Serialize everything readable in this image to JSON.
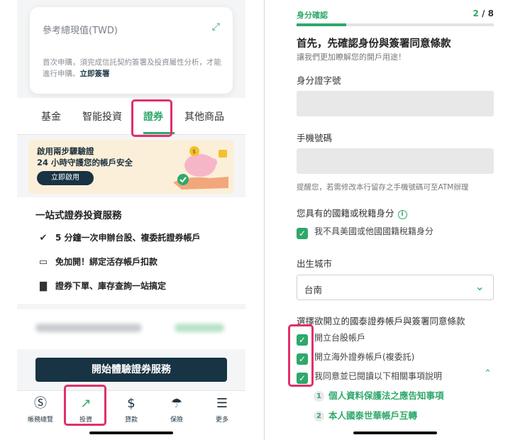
{
  "left": {
    "value_card": {
      "title": "參考總現值(TWD)",
      "expand_icon": "expand-icon",
      "desc_prefix": "首次申購，須完成信託契約簽署及投資屬性分析，才能進行申購。",
      "desc_link": "立即簽署"
    },
    "tabs": [
      "基金",
      "智能投資",
      "證券",
      "其他商品"
    ],
    "active_tab": "證券",
    "promo": {
      "line1": "啟用兩步驟驗證",
      "line2": "24 小時守護您的帳戶安全",
      "button": "立即啟用"
    },
    "service": {
      "title": "一站式證券投資服務",
      "rows": [
        {
          "icon": "speed-check-icon",
          "text": "5 分鐘一次申辦台股、複委託證券帳戶"
        },
        {
          "icon": "bank-card-icon",
          "text": "免加開！綁定活存帳戶扣款"
        },
        {
          "icon": "growth-chart-icon",
          "text": "證券下單、庫存查詢一站搞定"
        }
      ]
    },
    "cta": "開始體驗證券服務",
    "nav": [
      {
        "icon": "dollar-circle-icon",
        "label": "帳務總覽"
      },
      {
        "icon": "invest-chart-icon",
        "label": "投資"
      },
      {
        "icon": "money-bag-icon",
        "label": "貸款"
      },
      {
        "icon": "umbrella-icon",
        "label": "保險"
      },
      {
        "icon": "menu-icon",
        "label": "更多"
      }
    ],
    "active_nav": "投資"
  },
  "right": {
    "step_name": "身分確認",
    "step_current": "2",
    "step_total": "/ 8",
    "progress": 0.25,
    "heading": "首先，先確認身份與簽署同意條款",
    "subheading": "讓我們更加瞭解您的開戶用途！",
    "id_label": "身分證字號",
    "phone_label": "手機號碼",
    "phone_hint": "提醒您，若需修改本行留存之手機號碼可至ATM辦理",
    "nationality_label": "您具有的國籍或稅籍身分",
    "nationality_option": "我不具美國或他國國籍稅籍身分",
    "birth_city_label": "出生城市",
    "birth_city_value": "台南",
    "accounts_label": "選擇欲開立的國泰證券帳戶與簽署同意條款",
    "account_options": [
      "開立台股帳戶",
      "開立海外證券帳戶(複委託)",
      "我同意並已閱讀以下相關事項說明"
    ],
    "notices": [
      {
        "num": "1",
        "text": "個人資料保護法之應告知事項"
      },
      {
        "num": "2",
        "text": "本人國泰世華帳戶互轉"
      }
    ]
  },
  "colors": {
    "accent_green": "#2fa86b",
    "navy": "#173344",
    "highlight": "#e0306a",
    "promo_bg": "#fcefd9"
  }
}
